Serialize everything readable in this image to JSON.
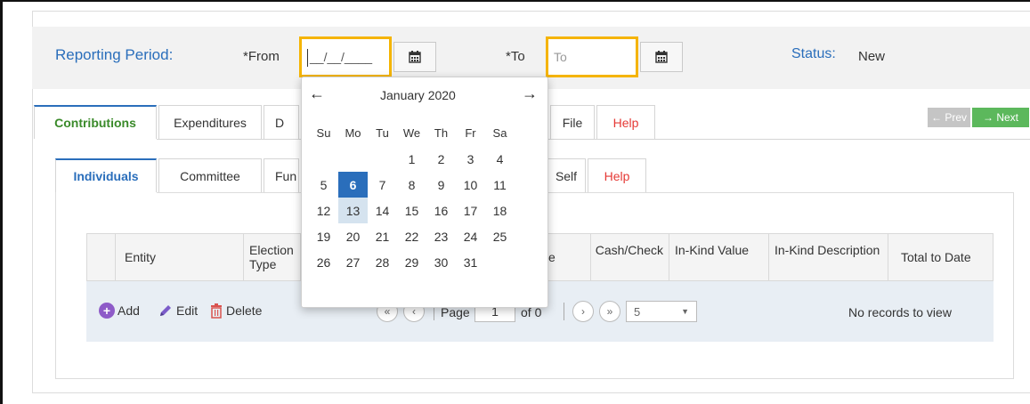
{
  "period": {
    "label": "Reporting Period:",
    "from_label": "*From",
    "from_value": "__/__/____",
    "to_label": "*To",
    "to_placeholder": "To",
    "status_label": "Status:",
    "status_value": "New"
  },
  "main_tabs": {
    "contributions": "Contributions",
    "expenditures": "Expenditures",
    "d_partial": "D",
    "file": "File",
    "help": "Help"
  },
  "pager_top": {
    "prev": "← Prev",
    "next": "→ Next"
  },
  "sub_tabs": {
    "individuals": "Individuals",
    "committee": "Committee",
    "fun_partial": "Fun",
    "self": "Self",
    "help": "Help"
  },
  "grid": {
    "columns": [
      "Entity",
      "Election Type",
      "e",
      "Cash/Check",
      "In-Kind Value",
      "In-Kind Description",
      "Total to Date"
    ],
    "actions": {
      "add": "Add",
      "edit": "Edit",
      "delete": "Delete"
    },
    "pager": {
      "page_label": "Page",
      "page_value": "1",
      "of_label": "of 0",
      "page_size": "5"
    },
    "empty_text": "No records to view"
  },
  "datepicker": {
    "title": "January 2020",
    "weekdays": [
      "Su",
      "Mo",
      "Tu",
      "We",
      "Th",
      "Fr",
      "Sa"
    ],
    "weeks": [
      [
        "",
        "",
        "",
        "1",
        "2",
        "3",
        "4"
      ],
      [
        "5",
        "6",
        "7",
        "8",
        "9",
        "10",
        "11"
      ],
      [
        "12",
        "13",
        "14",
        "15",
        "16",
        "17",
        "18"
      ],
      [
        "19",
        "20",
        "21",
        "22",
        "23",
        "24",
        "25"
      ],
      [
        "26",
        "27",
        "28",
        "29",
        "30",
        "31",
        ""
      ]
    ],
    "selected_day": "6",
    "hover_day": "13"
  },
  "colors": {
    "accent_blue": "#2a6ebb",
    "highlight_yellow": "#f5b400",
    "help_red": "#e53935",
    "next_green": "#5cb85c"
  }
}
